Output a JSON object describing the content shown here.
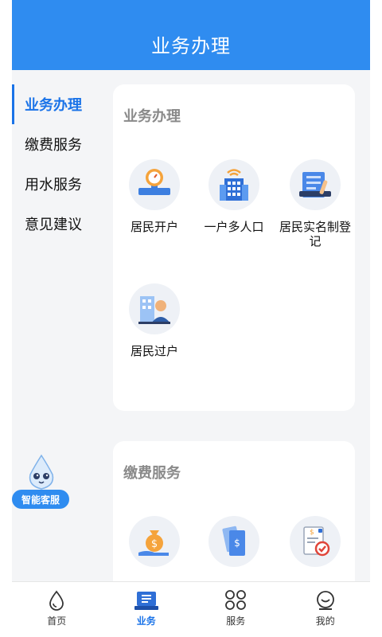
{
  "header": {
    "title": "业务办理"
  },
  "sidebar": {
    "items": [
      {
        "label": "业务办理"
      },
      {
        "label": "缴费服务"
      },
      {
        "label": "用水服务"
      },
      {
        "label": "意见建议"
      }
    ],
    "active_index": 0
  },
  "sections": [
    {
      "title": "业务办理",
      "items": [
        {
          "label": "居民开户",
          "icon": "water-meter-icon"
        },
        {
          "label": "一户多人口",
          "icon": "building-icon"
        },
        {
          "label": "居民实名制登记",
          "icon": "id-registration-icon"
        },
        {
          "label": "居民过户",
          "icon": "person-transfer-icon"
        }
      ]
    },
    {
      "title": "缴费服务",
      "items": [
        {
          "icon": "money-bag-icon"
        },
        {
          "icon": "bill-receipt-icon"
        },
        {
          "icon": "payment-record-icon"
        }
      ]
    }
  ],
  "assistant": {
    "label": "智能客服"
  },
  "tabbar": {
    "items": [
      {
        "label": "首页",
        "icon": "water-drop-icon"
      },
      {
        "label": "业务",
        "icon": "business-icon"
      },
      {
        "label": "服务",
        "icon": "services-grid-icon"
      },
      {
        "label": "我的",
        "icon": "profile-icon"
      }
    ],
    "active_index": 1
  },
  "colors": {
    "primary": "#2f8cf0",
    "active_text": "#1a73e8",
    "background": "#f4f5f7"
  }
}
